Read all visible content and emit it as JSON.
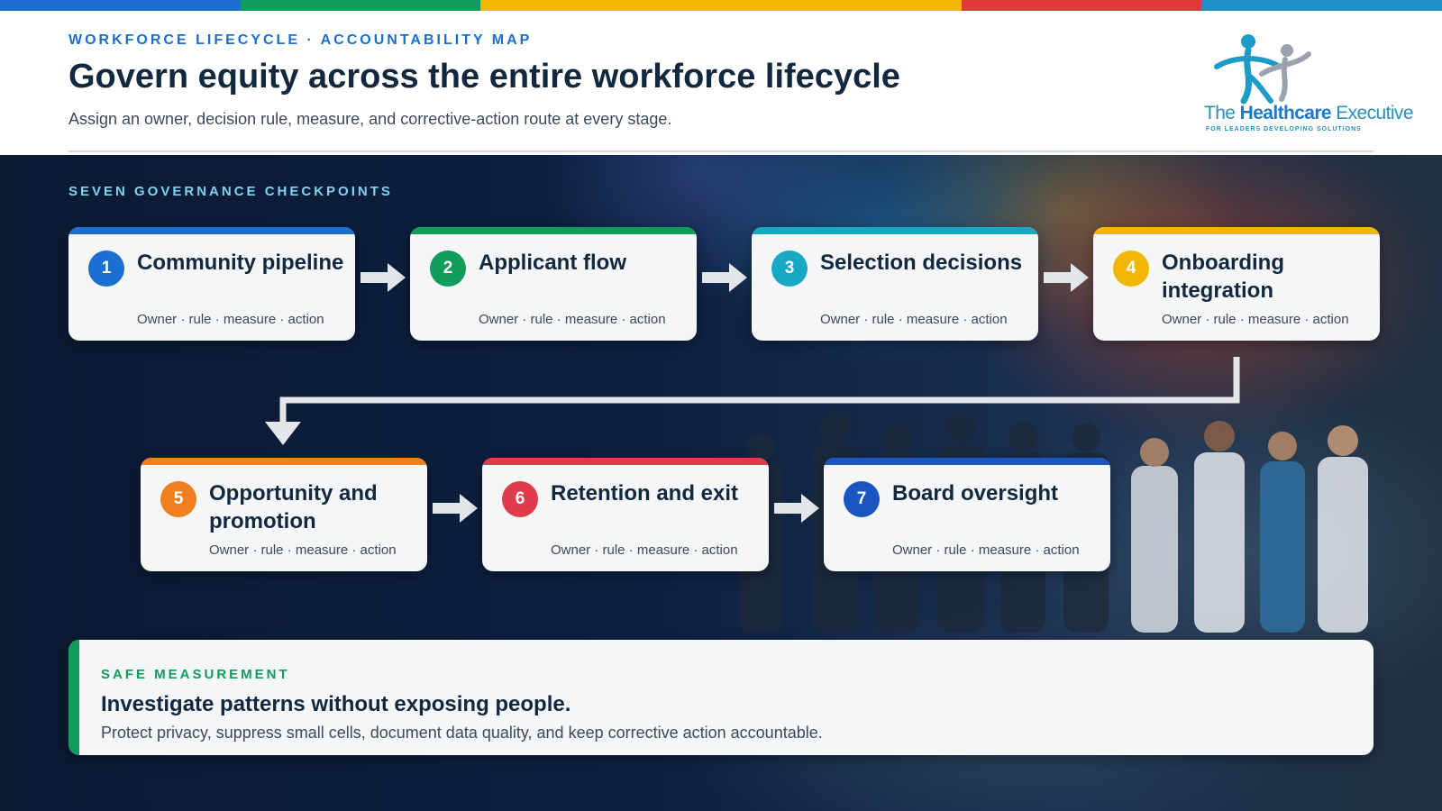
{
  "brand_colors": [
    "#1a6fd0",
    "#109c5a",
    "#f2b705",
    "#e03b3b",
    "#1e90c8"
  ],
  "header": {
    "eyebrow": "WORKFORCE LIFECYCLE · ACCOUNTABILITY MAP",
    "title": "Govern equity across the entire workforce lifecycle",
    "subtitle": "Assign an owner, decision rule, measure, and corrective-action route at every stage."
  },
  "logo": {
    "prefix": "The ",
    "highlight": "Healthcare",
    "suffix": " Executive",
    "tagline": "FOR LEADERS DEVELOPING SOLUTIONS",
    "icon": "figures-icon"
  },
  "section_label": "SEVEN GOVERNANCE CHECKPOINTS",
  "steps": [
    {
      "number": "1",
      "title": "Community pipeline",
      "meta": "Owner · rule · measure · action",
      "color": "#1a6fd0"
    },
    {
      "number": "2",
      "title": "Applicant flow",
      "meta": "Owner · rule · measure · action",
      "color": "#109c5a"
    },
    {
      "number": "3",
      "title": "Selection decisions",
      "meta": "Owner · rule · measure · action",
      "color": "#17a8c4"
    },
    {
      "number": "4",
      "title": "Onboarding integration",
      "meta": "Owner · rule · measure · action",
      "color": "#f2b705"
    },
    {
      "number": "5",
      "title": "Opportunity and promotion",
      "meta": "Owner · rule · measure · action",
      "color": "#f07f1f"
    },
    {
      "number": "6",
      "title": "Retention and exit",
      "meta": "Owner · rule · measure · action",
      "color": "#e03b4b"
    },
    {
      "number": "7",
      "title": "Board oversight",
      "meta": "Owner · rule · measure · action",
      "color": "#1a55c0"
    }
  ],
  "callout": {
    "eyebrow": "SAFE MEASUREMENT",
    "title": "Investigate patterns without exposing people.",
    "body": "Protect privacy, suppress small cells, document data quality, and keep corrective action accountable."
  }
}
